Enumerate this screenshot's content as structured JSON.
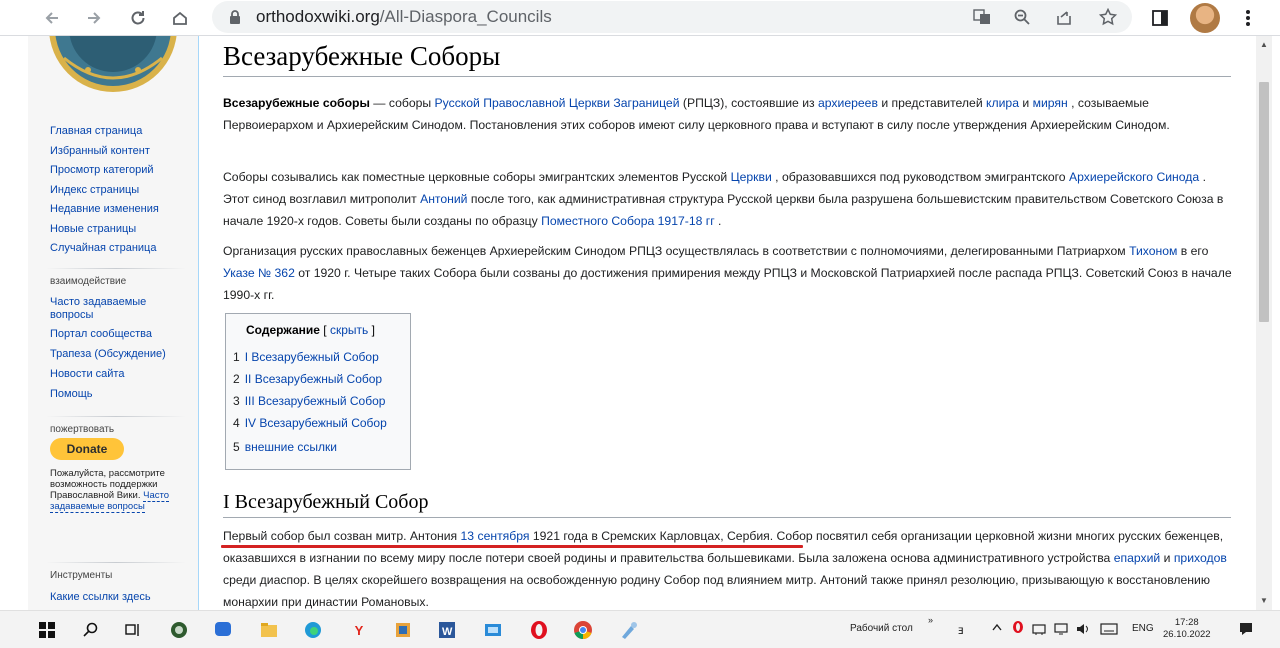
{
  "browser": {
    "url_host": "orthodoxwiki.org",
    "url_path": "/All-Diaspora_Councils"
  },
  "sidebar": {
    "nav": [
      "Главная страница",
      "Избранный контент",
      "Просмотр категорий",
      "Индекс страницы",
      "Недавние изменения",
      "Новые страницы",
      "Случайная страница"
    ],
    "interaction_heading": "взаимодействие",
    "interaction": [
      "Часто задаваемые",
      "вопросы",
      "Портал сообщества",
      "Трапеза (Обсуждение)",
      "Новости сайта",
      "Помощь"
    ],
    "donate_heading": "пожертвовать",
    "donate_label": "Donate",
    "donate_note": "Пожалуйста, рассмотрите возможность поддержки Православной Вики.",
    "donate_faq": "Часто задаваемые вопросы",
    "tools_heading": "Инструменты",
    "tools": [
      "Какие ссылки здесь"
    ]
  },
  "article": {
    "title": "Всезарубежные Соборы",
    "p1": {
      "bold": "Всезарубежные соборы",
      "t1": " — соборы ",
      "l1": "Русской Православной Церкви Заграницей",
      "t2": " (РПЦЗ), состоявшие из ",
      "l2": "архиереев",
      "t3": " и представителей ",
      "l3": "клира",
      "t4": " и ",
      "l4": "мирян",
      "t5": " , созываемые Первоиерархом и Архиерейским Синодом. Постановления этих соборов имеют силу церковного права и вступают в силу после утверждения Архиерейским Синодом."
    },
    "p2": {
      "t1": "Соборы созывались как поместные церковные соборы эмигрантских элементов Русской ",
      "l1": "Церкви",
      "t2": " , образовавшихся под руководством эмигрантского ",
      "l2": "Архиерейского Синода",
      "t3": " . Этот синод возглавил митрополит ",
      "l3": "Антоний",
      "t4": " после того, как административная структура Русской церкви была разрушена большевистским правительством Советского Союза в начале 1920-х годов. Советы были созданы по образцу ",
      "l4": "Поместного Собора 1917-18 гг",
      "t5": " ."
    },
    "p3": {
      "t1": "Организация русских православных беженцев Архиерейским Синодом РПЦЗ осуществлялась в соответствии с полномочиями, делегированными Патриархом ",
      "l1": "Тихоном",
      "t2": " в его ",
      "l2": "Указе № 362",
      "t3": " от 1920 г. Четыре таких Собора были созваны до достижения примирения между РПЦЗ и Московской Патриархией после распада РПЦЗ. Советский Союз в начале 1990-х гг."
    },
    "toc": {
      "heading": "Содержание",
      "bracket_open": " [ ",
      "toggle": "скрыть",
      "bracket_close": " ]",
      "items": [
        {
          "num": "1",
          "label": "I Всезарубежный Собор"
        },
        {
          "num": "2",
          "label": "II Всезарубежный Собор"
        },
        {
          "num": "3",
          "label": "III Всезарубежный Собор"
        },
        {
          "num": "4",
          "label": "IV Всезарубежный Собор"
        },
        {
          "num": "5",
          "label": "внешние ссылки"
        }
      ]
    },
    "section1_title": "I Всезарубежный Собор",
    "p4": {
      "t1": "Первый собор был созван митр. Антония ",
      "l1": "13 сентября",
      "t2": " 1921 года в Сремских Карловцах, Сербия. Собор посвятил себя организации церковной жизни многих русских беженцев, оказавшихся в изгнании по всему миру после потери своей родины и правительства большевиками. Была заложена основа административного устройства ",
      "l2": "епархий",
      "t3": " и ",
      "l3": "приходов",
      "t4": " среди диаспор. В целях скорейшего возвращения на освобожденную родину Собор под влиянием митр. Антоний также принял резолюцию, призывающую к восстановлению монархии при династии Романовых."
    }
  },
  "taskbar": {
    "desktop_label": "Рабочий стол",
    "lang": "ENG",
    "time": "17:28",
    "date": "26.10.2022"
  },
  "colors": {
    "link": "#0645ad",
    "donate": "#ffc439",
    "underline_annotation": "#d42222"
  }
}
